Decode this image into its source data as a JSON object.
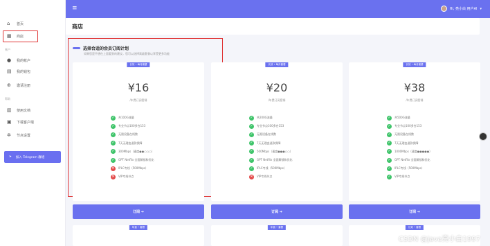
{
  "sidebar": {
    "items": [
      {
        "icon": "home-icon",
        "label": "首页"
      },
      {
        "icon": "shop-icon",
        "label": "商店"
      }
    ],
    "groups": [
      {
        "label": "帐户",
        "items": [
          {
            "icon": "user-icon",
            "label": "我的帐户"
          },
          {
            "icon": "wallet-icon",
            "label": "我的钱包"
          },
          {
            "icon": "invite-icon",
            "label": "邀请注册"
          }
        ]
      },
      {
        "label": "帮助",
        "items": [
          {
            "icon": "doc-icon",
            "label": "使用文档"
          },
          {
            "icon": "download-icon",
            "label": "下载客户端"
          },
          {
            "icon": "settings-icon",
            "label": "节点设置"
          }
        ]
      }
    ],
    "telegram_label": "加入 Telegram 群组"
  },
  "topbar": {
    "user_label": "Hi, 亮小白 用户AI"
  },
  "page_title": "商店",
  "plans_title": "选择合适的会员订阅计划",
  "plans_subtitle": "如果您是不想在上面看到的建议，您可以选择高级套餐以享受更多功能",
  "plans": [
    {
      "badge": "长效 • 每月套餐",
      "price": "¥16",
      "period": "/年费订阅套餐",
      "features": [
        {
          "ok": true,
          "text": "共100G流量"
        },
        {
          "ok": true,
          "text": "专业节点100多台153"
        },
        {
          "ok": true,
          "text": "无限设备在线数"
        },
        {
          "ok": true,
          "text": "7天无理由退款保障"
        },
        {
          "ok": true,
          "text": "300Mbps（速度●●○○○）"
        },
        {
          "ok": true,
          "text": "GPT Netflix 全面解锁和优化"
        },
        {
          "ok": false,
          "text": "IPLC专线（500Mbps）"
        },
        {
          "ok": false,
          "text": "VIP专线节点"
        }
      ],
      "order_label": "订阅 ➔"
    },
    {
      "badge": "长效 • 每月套餐",
      "price": "¥20",
      "period": "/年费订阅套餐",
      "features": [
        {
          "ok": true,
          "text": "共200G流量"
        },
        {
          "ok": true,
          "text": "专业节点100多台153"
        },
        {
          "ok": true,
          "text": "无限设备在线数"
        },
        {
          "ok": true,
          "text": "7天无理由退款保障"
        },
        {
          "ok": true,
          "text": "500Mbps（速度●●●○○）"
        },
        {
          "ok": true,
          "text": "GPT Netflix 全面解锁和优化"
        },
        {
          "ok": true,
          "text": "IPLC专线（500Mbps）"
        },
        {
          "ok": false,
          "text": "VIP专线节点"
        }
      ],
      "order_label": "订阅 ➔"
    },
    {
      "badge": "长效 • 每月套餐",
      "price": "¥38",
      "period": "/年费订阅套餐",
      "features": [
        {
          "ok": true,
          "text": "共500G流量"
        },
        {
          "ok": true,
          "text": "专业节点100多台153"
        },
        {
          "ok": true,
          "text": "无限设备在线数"
        },
        {
          "ok": true,
          "text": "7天无理由退款保障"
        },
        {
          "ok": true,
          "text": "1000Mbps（速度●●●●●）"
        },
        {
          "ok": true,
          "text": "GPT Netflix 全面解锁和优化"
        },
        {
          "ok": true,
          "text": "IPLC专线（500Mbps）"
        },
        {
          "ok": true,
          "text": "VIP专线节点"
        }
      ],
      "order_label": "订阅 ➔"
    }
  ],
  "next_row_badges": [
    "年费 • 套餐",
    "年费 • 套餐",
    "长效 • 套餐"
  ],
  "watermark": "CSDN @java亮小白1997",
  "colors": {
    "accent": "#6a71ef",
    "ok": "#3fc46a",
    "no": "#e34b4b",
    "highlight": "#e03535"
  }
}
